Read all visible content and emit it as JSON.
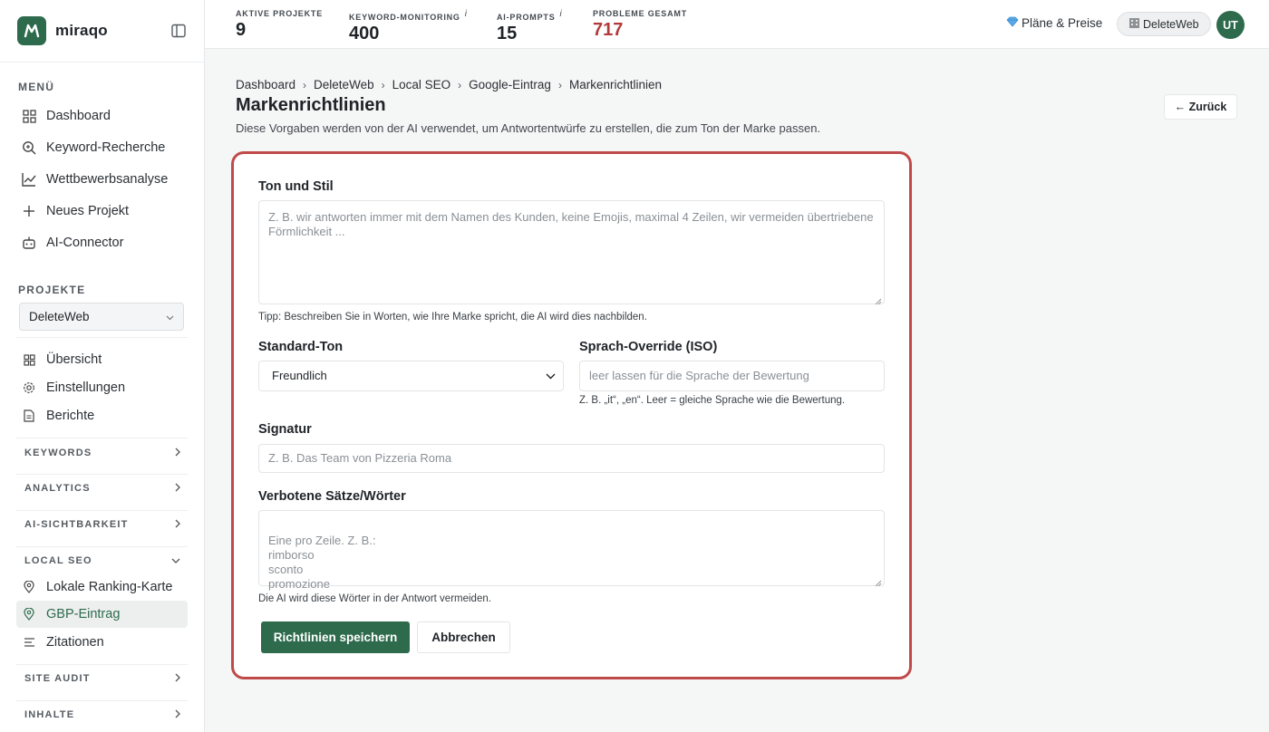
{
  "brand": {
    "name": "miraqo"
  },
  "sidebar": {
    "menu_title": "MENÜ",
    "menu": [
      {
        "label": "Dashboard",
        "icon": "grid-icon"
      },
      {
        "label": "Keyword-Recherche",
        "icon": "search-icon"
      },
      {
        "label": "Wettbewerbsanalyse",
        "icon": "chart-icon"
      },
      {
        "label": "Neues Projekt",
        "icon": "plus-icon"
      },
      {
        "label": "AI-Connector",
        "icon": "robot-icon"
      }
    ],
    "projects_title": "PROJEKTE",
    "project_select": "DeleteWeb",
    "project_items": [
      {
        "label": "Übersicht",
        "icon": "grid-icon"
      },
      {
        "label": "Einstellungen",
        "icon": "gear-icon"
      },
      {
        "label": "Berichte",
        "icon": "document-icon"
      }
    ],
    "groups": {
      "keywords": "KEYWORDS",
      "analytics": "ANALYTICS",
      "ai_visibility": "AI-SICHTBARKEIT",
      "local_seo": "LOCAL SEO",
      "site_audit": "SITE AUDIT",
      "content": "INHALTE"
    },
    "local_items": [
      {
        "label": "Lokale Ranking-Karte",
        "icon": "map-pin-icon"
      },
      {
        "label": "GBP-Eintrag",
        "icon": "map-pin-icon",
        "active": true
      },
      {
        "label": "Zitationen",
        "icon": "list-icon"
      }
    ]
  },
  "topbar": {
    "stats": [
      {
        "label": "AKTIVE PROJEKTE",
        "value": "9"
      },
      {
        "label": "KEYWORD-MONITORING",
        "info": "i",
        "value": "400"
      },
      {
        "label": "AI-PROMPTS",
        "info": "i",
        "value": "15"
      },
      {
        "label": "PROBLEME GESAMT",
        "value": "717"
      }
    ],
    "plans_label": "Pläne & Preise",
    "project_pill": "DeleteWeb",
    "avatar_initials": "UT"
  },
  "breadcrumb": [
    "Dashboard",
    "DeleteWeb",
    "Local SEO",
    "Google-Eintrag",
    "Markenrichtlinien"
  ],
  "page": {
    "title": "Markenrichtlinien",
    "description": "Diese Vorgaben werden von der AI verwendet, um Antwortentwürfe zu erstellen, die zum Ton der Marke passen.",
    "back_label": "← Zurück"
  },
  "form": {
    "tone_label": "Ton und Stil",
    "tone_placeholder": "Z. B. wir antworten immer mit dem Namen des Kunden, keine Emojis, maximal 4 Zeilen, wir vermeiden übertriebene Förmlichkeit ...",
    "tone_hint": "Tipp: Beschreiben Sie in Worten, wie Ihre Marke spricht, die AI wird dies nachbilden.",
    "default_tone_label": "Standard-Ton",
    "default_tone_value": "Freundlich",
    "lang_label": "Sprach-Override (ISO)",
    "lang_placeholder": "leer lassen für die Sprache der Bewertung",
    "lang_hint": "Z. B. „it“, „en“. Leer = gleiche Sprache wie die Bewertung.",
    "signature_label": "Signatur",
    "signature_placeholder": "Z. B. Das Team von Pizzeria Roma",
    "forbidden_label": "Verbotene Sätze/Wörter",
    "forbidden_placeholder": "Eine pro Zeile. Z. B.:\nrimborso\nsconto\npromozione",
    "forbidden_hint": "Die AI wird diese Wörter in der Antwort vermeiden.",
    "save_label": "Richtlinien speichern",
    "cancel_label": "Abbrechen"
  },
  "colors": {
    "accent": "#2e6b4d",
    "danger": "#b33a3a",
    "highlight": "#c04a4a"
  }
}
